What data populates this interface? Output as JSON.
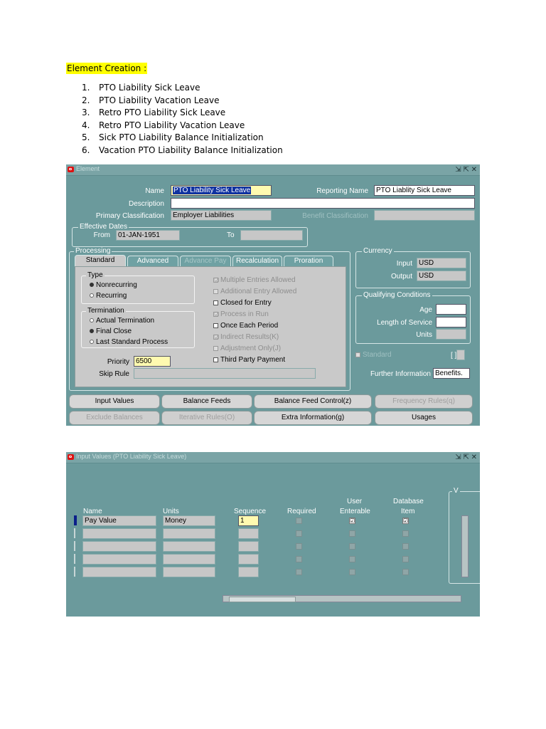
{
  "doc": {
    "heading": "Element Creation :",
    "items": [
      {
        "num": "1.",
        "text": "PTO Liability Sick Leave"
      },
      {
        "num": "2.",
        "text": "PTO Liability Vacation Leave"
      },
      {
        "num": "3.",
        "text": "Retro PTO Liability Sick Leave"
      },
      {
        "num": "4.",
        "text": "Retro PTO Liability Vacation Leave"
      },
      {
        "num": "5.",
        "text": "Sick PTO Liability Balance Initialization"
      },
      {
        "num": "6.",
        "text": "Vacation PTO Liability Balance Initialization"
      }
    ]
  },
  "element_form": {
    "title": "Element",
    "controls": "⇲ ⇱ ✕",
    "name_label": "Name",
    "name_value": "PTO Liability Sick Leave",
    "reporting_name_label": "Reporting Name",
    "reporting_name_value": "PTO Liablity Sick Leave",
    "description_label": "Description",
    "primary_classification_label": "Primary Classification",
    "primary_classification_value": "Employer Liabilities",
    "benefit_classification_label": "Benefit Classification",
    "effective_dates_label": "Effective Dates",
    "from_label": "From",
    "from_value": "01-JAN-1951",
    "to_label": "To",
    "processing_label": "Processing",
    "tabs": [
      "Standard",
      "Advanced",
      "Advance Pay",
      "Recalculation",
      "Proration"
    ],
    "type_label": "Type",
    "type_options": [
      "Nonrecurring",
      "Recurring"
    ],
    "termination_label": "Termination",
    "termination_options": [
      "Actual Termination",
      "Final Close",
      "Last Standard Process"
    ],
    "checkboxes": [
      {
        "label": "Multiple Entries Allowed",
        "checked": "☑"
      },
      {
        "label": "Additional Entry Allowed",
        "checked": ""
      },
      {
        "label": "Closed for Entry",
        "checked": ""
      },
      {
        "label": "Process in Run",
        "checked": "☑"
      },
      {
        "label": "Once Each Period",
        "checked": ""
      },
      {
        "label": "Indirect Results(K)",
        "checked": "☑"
      },
      {
        "label": "Adjustment Only(J)",
        "checked": ""
      },
      {
        "label": "Third Party Payment",
        "checked": ""
      }
    ],
    "priority_label": "Priority",
    "priority_value": "6500",
    "skip_rule_label": "Skip Rule",
    "currency_label": "Currency",
    "input_label": "Input",
    "input_value": "USD",
    "output_label": "Output",
    "output_value": "USD",
    "qualifying_label": "Qualifying Conditions",
    "age_label": "Age",
    "length_label": "Length of Service",
    "units_label": "Units",
    "standard_label": "Standard",
    "bracket_label": "[ ]",
    "further_info_label": "Further Information",
    "further_info_value": "Benefits.",
    "buttons_row1": [
      "Input Values",
      "Balance Feeds",
      "Balance Feed Control(z)",
      "Frequency Rules(q)"
    ],
    "buttons_row2": [
      "Exclude Balances",
      "Iterative Rules(O)",
      "Extra Information(g)",
      "Usages"
    ]
  },
  "input_values_form": {
    "title": "Input Values (PTO Liability Sick Leave)",
    "controls": "⇲ ⇱ ✕",
    "v_label": "V",
    "col_name": "Name",
    "col_units": "Units",
    "col_sequence": "Sequence",
    "col_required": "Required",
    "col_user_enterable_1": "User",
    "col_user_enterable_2": "Enterable",
    "col_database_item_1": "Database",
    "col_database_item_2": "Item",
    "rows": [
      {
        "name": "Pay Value",
        "units": "Money",
        "sequence": "1",
        "user": "☑",
        "db": "☑"
      },
      {
        "name": "",
        "units": "",
        "sequence": "",
        "user": "",
        "db": ""
      },
      {
        "name": "",
        "units": "",
        "sequence": "",
        "user": "",
        "db": ""
      },
      {
        "name": "",
        "units": "",
        "sequence": "",
        "user": "",
        "db": ""
      },
      {
        "name": "",
        "units": "",
        "sequence": "",
        "user": "",
        "db": ""
      }
    ]
  }
}
